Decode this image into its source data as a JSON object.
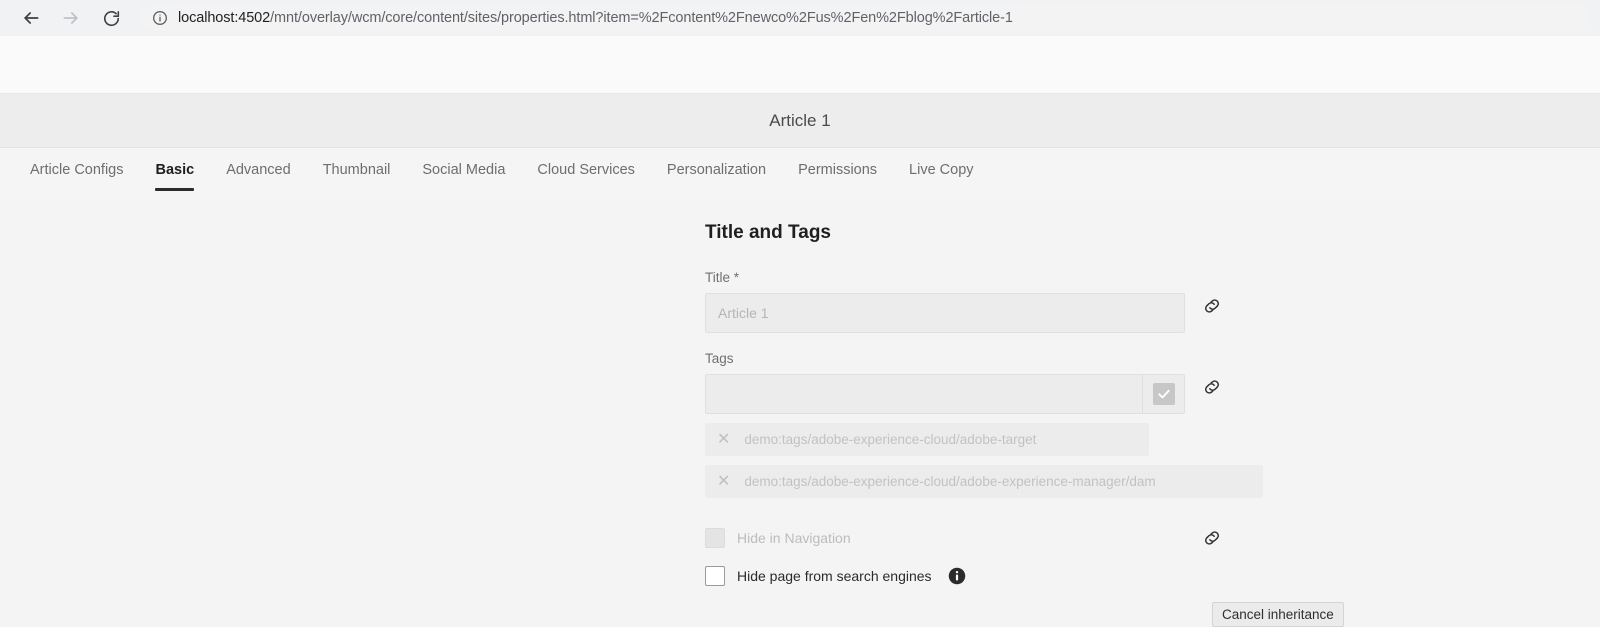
{
  "browser": {
    "back_icon": "arrow-left-icon",
    "forward_icon": "arrow-right-icon",
    "reload_icon": "reload-icon",
    "site_info_icon": "info-circle-icon",
    "url_host": "localhost:4502",
    "url_path": "/mnt/overlay/wcm/core/content/sites/properties.html?item=%2Fcontent%2Fnewco%2Fus%2Fen%2Fblog%2Farticle-1"
  },
  "page": {
    "title": "Article 1"
  },
  "tabs": [
    {
      "label": "Article Configs",
      "active": false
    },
    {
      "label": "Basic",
      "active": true
    },
    {
      "label": "Advanced",
      "active": false
    },
    {
      "label": "Thumbnail",
      "active": false
    },
    {
      "label": "Social Media",
      "active": false
    },
    {
      "label": "Cloud Services",
      "active": false
    },
    {
      "label": "Personalization",
      "active": false
    },
    {
      "label": "Permissions",
      "active": false
    },
    {
      "label": "Live Copy",
      "active": false
    }
  ],
  "form": {
    "section_title": "Title and Tags",
    "title_field": {
      "label": "Title *",
      "value": "",
      "placeholder": "Article 1",
      "disabled": true
    },
    "tags_field": {
      "label": "Tags",
      "value": "",
      "placeholder": "",
      "picker_icon": "checkmark-icon",
      "disabled": true
    },
    "tags": [
      {
        "remove_icon": "close-icon",
        "label": "demo:tags/adobe-experience-cloud/adobe-target"
      },
      {
        "remove_icon": "close-icon",
        "label": "demo:tags/adobe-experience-cloud/adobe-experience-manager/dam"
      }
    ],
    "hide_in_navigation": {
      "label": "Hide in Navigation",
      "checked": false,
      "disabled": true
    },
    "hide_from_search": {
      "label": "Hide page from search engines",
      "checked": false,
      "disabled": false,
      "info_icon": "info-filled-icon"
    },
    "inheritance_icons": {
      "icon_name": "broken-chain-link-icon",
      "count": 3
    }
  },
  "tooltip": {
    "text": "Cancel inheritance",
    "visible": true
  },
  "colors": {
    "browser_chrome": "#f1f2f4",
    "white_band": "#fafafa",
    "page_header": "#ededed",
    "tabbar": "#f5f5f5",
    "content_bg": "#f4f4f4",
    "active_tab_underline": "#2b2b2b",
    "disabled_field": "#ececec"
  }
}
